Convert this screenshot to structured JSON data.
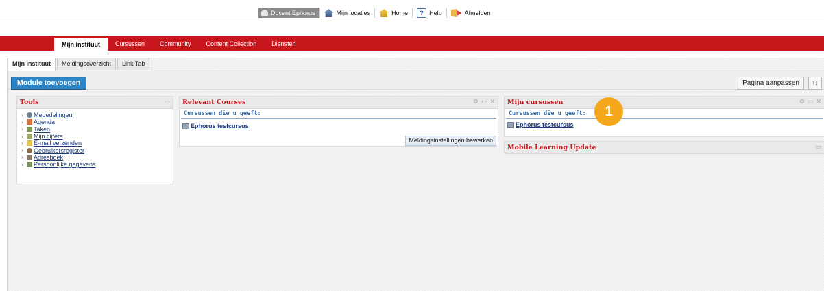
{
  "topnav": {
    "user": "Docent Ephorus",
    "items": [
      {
        "label": "Mijn locaties",
        "icon": "location-icon"
      },
      {
        "label": "Home",
        "icon": "home-icon"
      },
      {
        "label": "Help",
        "icon": "help-icon",
        "glyph": "?"
      },
      {
        "label": "Afmelden",
        "icon": "logout-icon"
      }
    ]
  },
  "maintabs": [
    "Mijn instituut",
    "Cursussen",
    "Community",
    "Content Collection",
    "Diensten"
  ],
  "subtabs": [
    "Mijn instituut",
    "Meldingsoverzicht",
    "Link Tab"
  ],
  "toolbar": {
    "add_module": "Module toevoegen",
    "customize_page": "Pagina aanpassen",
    "sort_glyph": "↑↓"
  },
  "tools": {
    "title": "Tools",
    "items": [
      "Mededelingen",
      "Agenda",
      "Taken",
      "Mijn cijfers",
      "E-mail verzenden",
      "Gebruikersregister",
      "Adresboek",
      "Persoonlijke gegevens"
    ]
  },
  "relevant": {
    "title": "Relevant Courses",
    "subhead": "Cursussen die u geeft:",
    "course": "Ephorus testcursus",
    "button": "Meldingsinstellingen bewerken"
  },
  "mijn": {
    "title": "Mijn cursussen",
    "subhead": "Cursussen die u geeft:",
    "course": "Ephorus testcursus"
  },
  "mobile": {
    "title": "Mobile Learning Update"
  },
  "badge": "1",
  "colors": {
    "brand_red": "#c8161d",
    "accent_blue": "#2b84c6",
    "badge_orange": "#f5a71c"
  }
}
